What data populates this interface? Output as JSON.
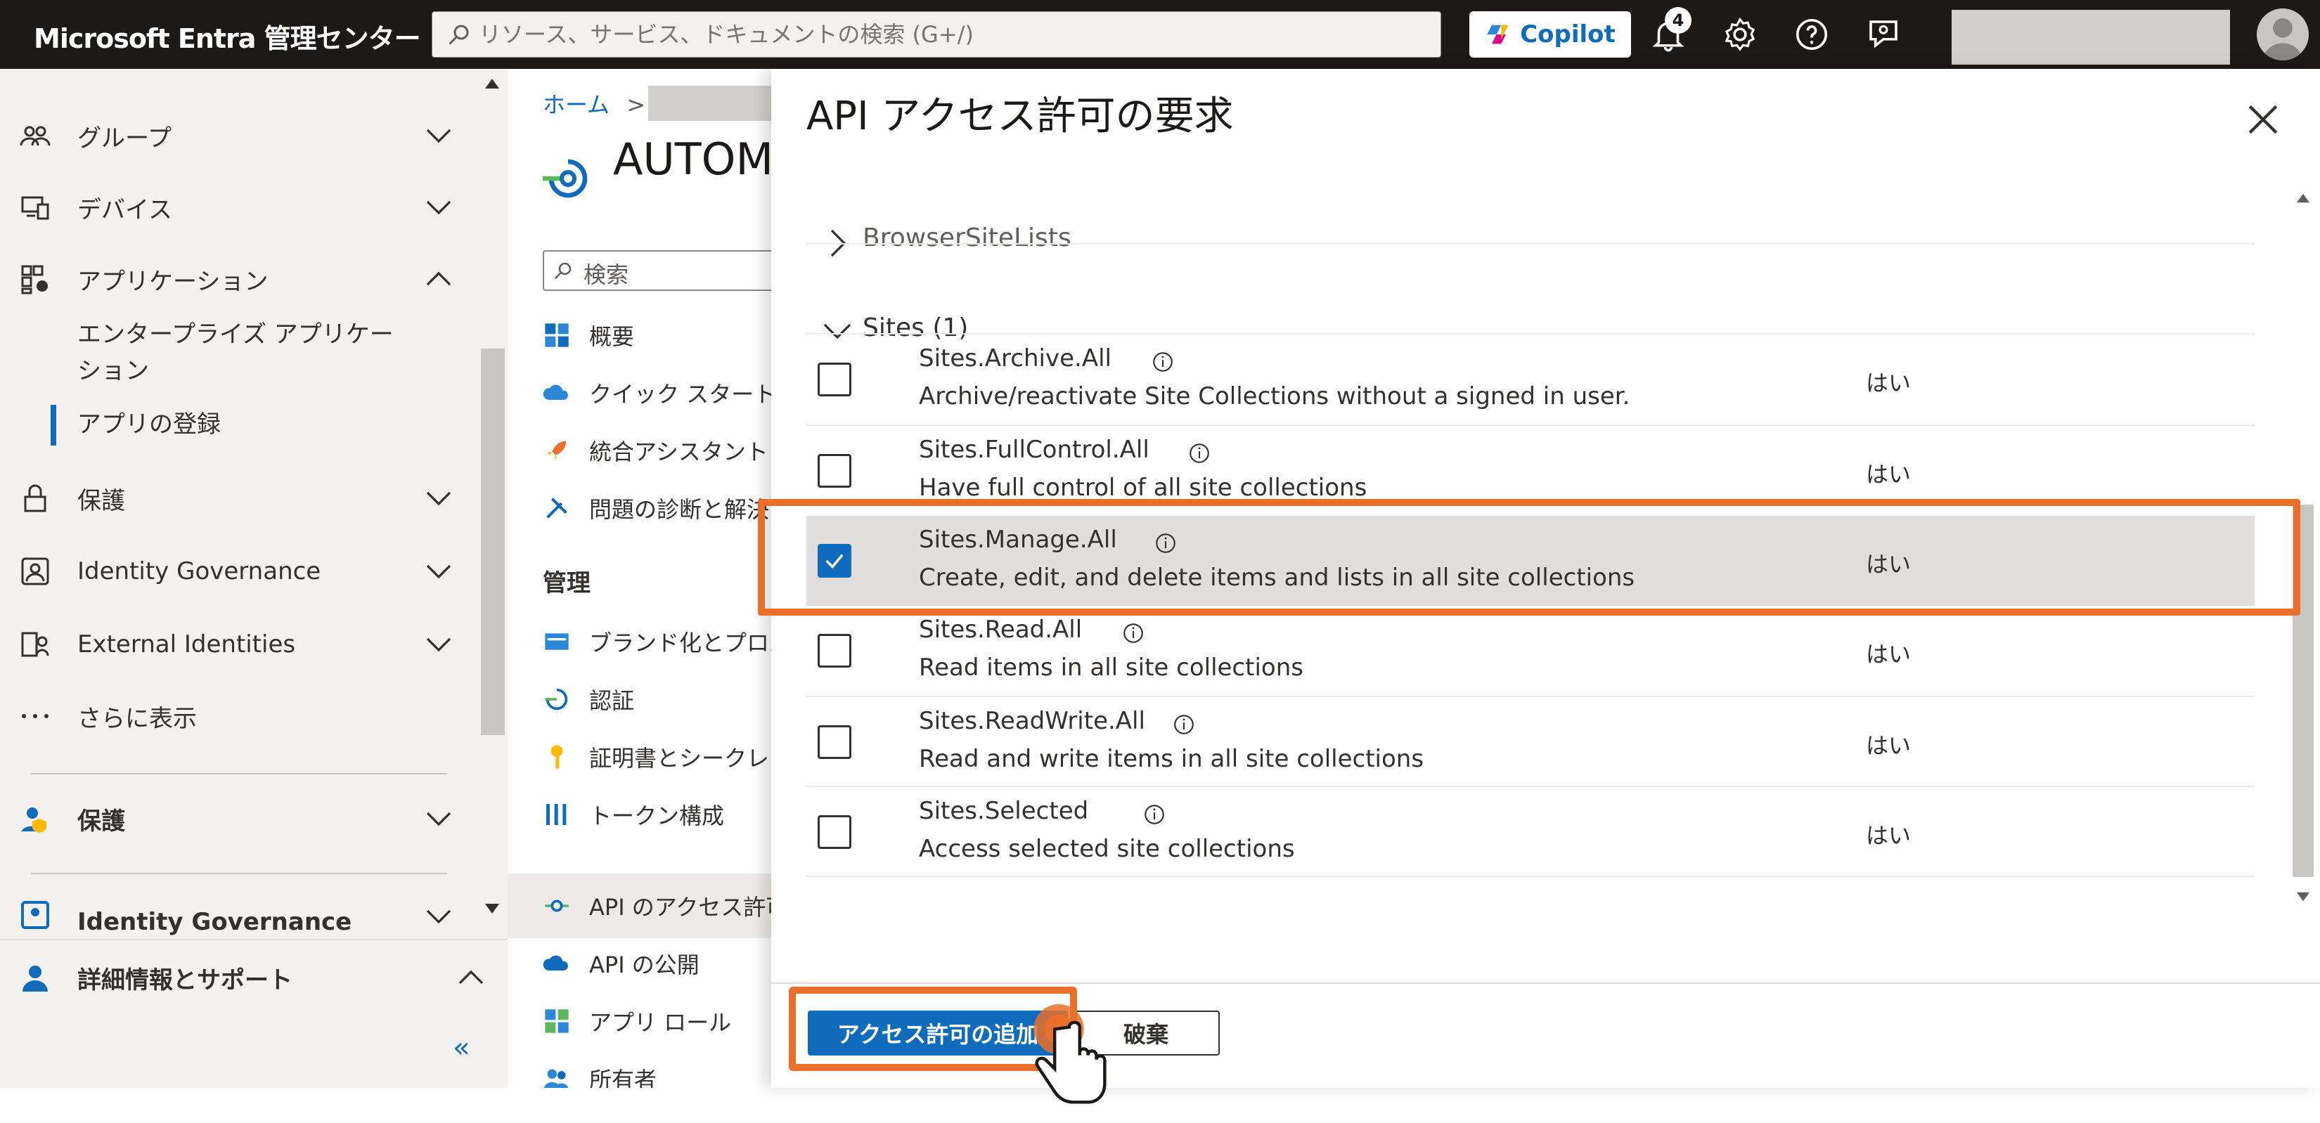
{
  "topbar": {
    "brand": "Microsoft Entra 管理センター",
    "search_placeholder": "リソース、サービス、ドキュメントの検索 (G+/)",
    "copilot_label": "Copilot",
    "notification_count": "4",
    "icons": [
      "search-icon",
      "copilot-icon",
      "bell-icon",
      "gear-icon",
      "help-icon",
      "feedback-icon",
      "avatar-icon"
    ]
  },
  "leftnav": {
    "items": [
      {
        "label": "グループ",
        "icon": "group-icon",
        "expanded": false
      },
      {
        "label": "デバイス",
        "icon": "device-icon",
        "expanded": false
      },
      {
        "label": "アプリケーション",
        "icon": "apps-icon",
        "expanded": true
      },
      {
        "label": "保護",
        "icon": "lock-icon",
        "expanded": false
      },
      {
        "label": "Identity Governance",
        "icon": "governance-icon",
        "expanded": false
      },
      {
        "label": "External Identities",
        "icon": "external-icon",
        "expanded": false
      },
      {
        "label": "さらに表示",
        "icon": "ellipsis-icon"
      }
    ],
    "sub_items": [
      "エンタープライズ アプリケーション",
      "アプリの登録"
    ],
    "enterprise_line1": "エンタープライズ アプリケー",
    "enterprise_line2": "ション",
    "section2_label": "保護",
    "section3_label": "Identity Governance",
    "support_label": "詳細情報とサポート",
    "collapse_glyph": "«"
  },
  "blade": {
    "breadcrumb_home": "ホーム",
    "breadcrumb_sep": ">",
    "app_title": "AUTOM",
    "search_placeholder": "検索",
    "menu": [
      {
        "label": "概要",
        "icon": "overview-icon"
      },
      {
        "label": "クイック スタート",
        "icon": "quickstart-icon"
      },
      {
        "label": "統合アシスタント",
        "icon": "rocket-icon"
      },
      {
        "label": "問題の診断と解決",
        "icon": "wrench-icon"
      }
    ],
    "manage_section": "管理",
    "manage_menu": [
      {
        "label": "ブランド化とプロパティ",
        "icon": "branding-icon"
      },
      {
        "label": "認証",
        "icon": "auth-icon"
      },
      {
        "label": "証明書とシークレット",
        "icon": "key-icon"
      },
      {
        "label": "トークン構成",
        "icon": "token-icon"
      },
      {
        "label": "API のアクセス許可",
        "icon": "api-icon",
        "selected": true
      },
      {
        "label": "API の公開",
        "icon": "cloud-icon"
      },
      {
        "label": "アプリ ロール",
        "icon": "roles-icon"
      },
      {
        "label": "所有者",
        "icon": "owners-icon"
      }
    ]
  },
  "panel": {
    "title": "API アクセス許可の要求",
    "group_collapsed": "BrowserSiteLists",
    "group_expanded": "Sites (1)",
    "permissions": [
      {
        "name": "Sites.Archive.All",
        "desc": "Archive/reactivate Site Collections without a signed in user.",
        "admin": "はい",
        "checked": false
      },
      {
        "name": "Sites.FullControl.All",
        "desc": "Have full control of all site collections",
        "admin": "はい",
        "checked": false
      },
      {
        "name": "Sites.Manage.All",
        "desc": "Create, edit, and delete items and lists in all site collections",
        "admin": "はい",
        "checked": true
      },
      {
        "name": "Sites.Read.All",
        "desc": "Read items in all site collections",
        "admin": "はい",
        "checked": false
      },
      {
        "name": "Sites.ReadWrite.All",
        "desc": "Read and write items in all site collections",
        "admin": "はい",
        "checked": false
      },
      {
        "name": "Sites.Selected",
        "desc": "Access selected site collections",
        "admin": "はい",
        "checked": false
      }
    ],
    "add_button": "アクセス許可の追加",
    "discard_button": "破棄"
  },
  "colors": {
    "accent": "#0f6cbd",
    "highlight": "#e9702a",
    "topbar": "#1b1a19"
  }
}
